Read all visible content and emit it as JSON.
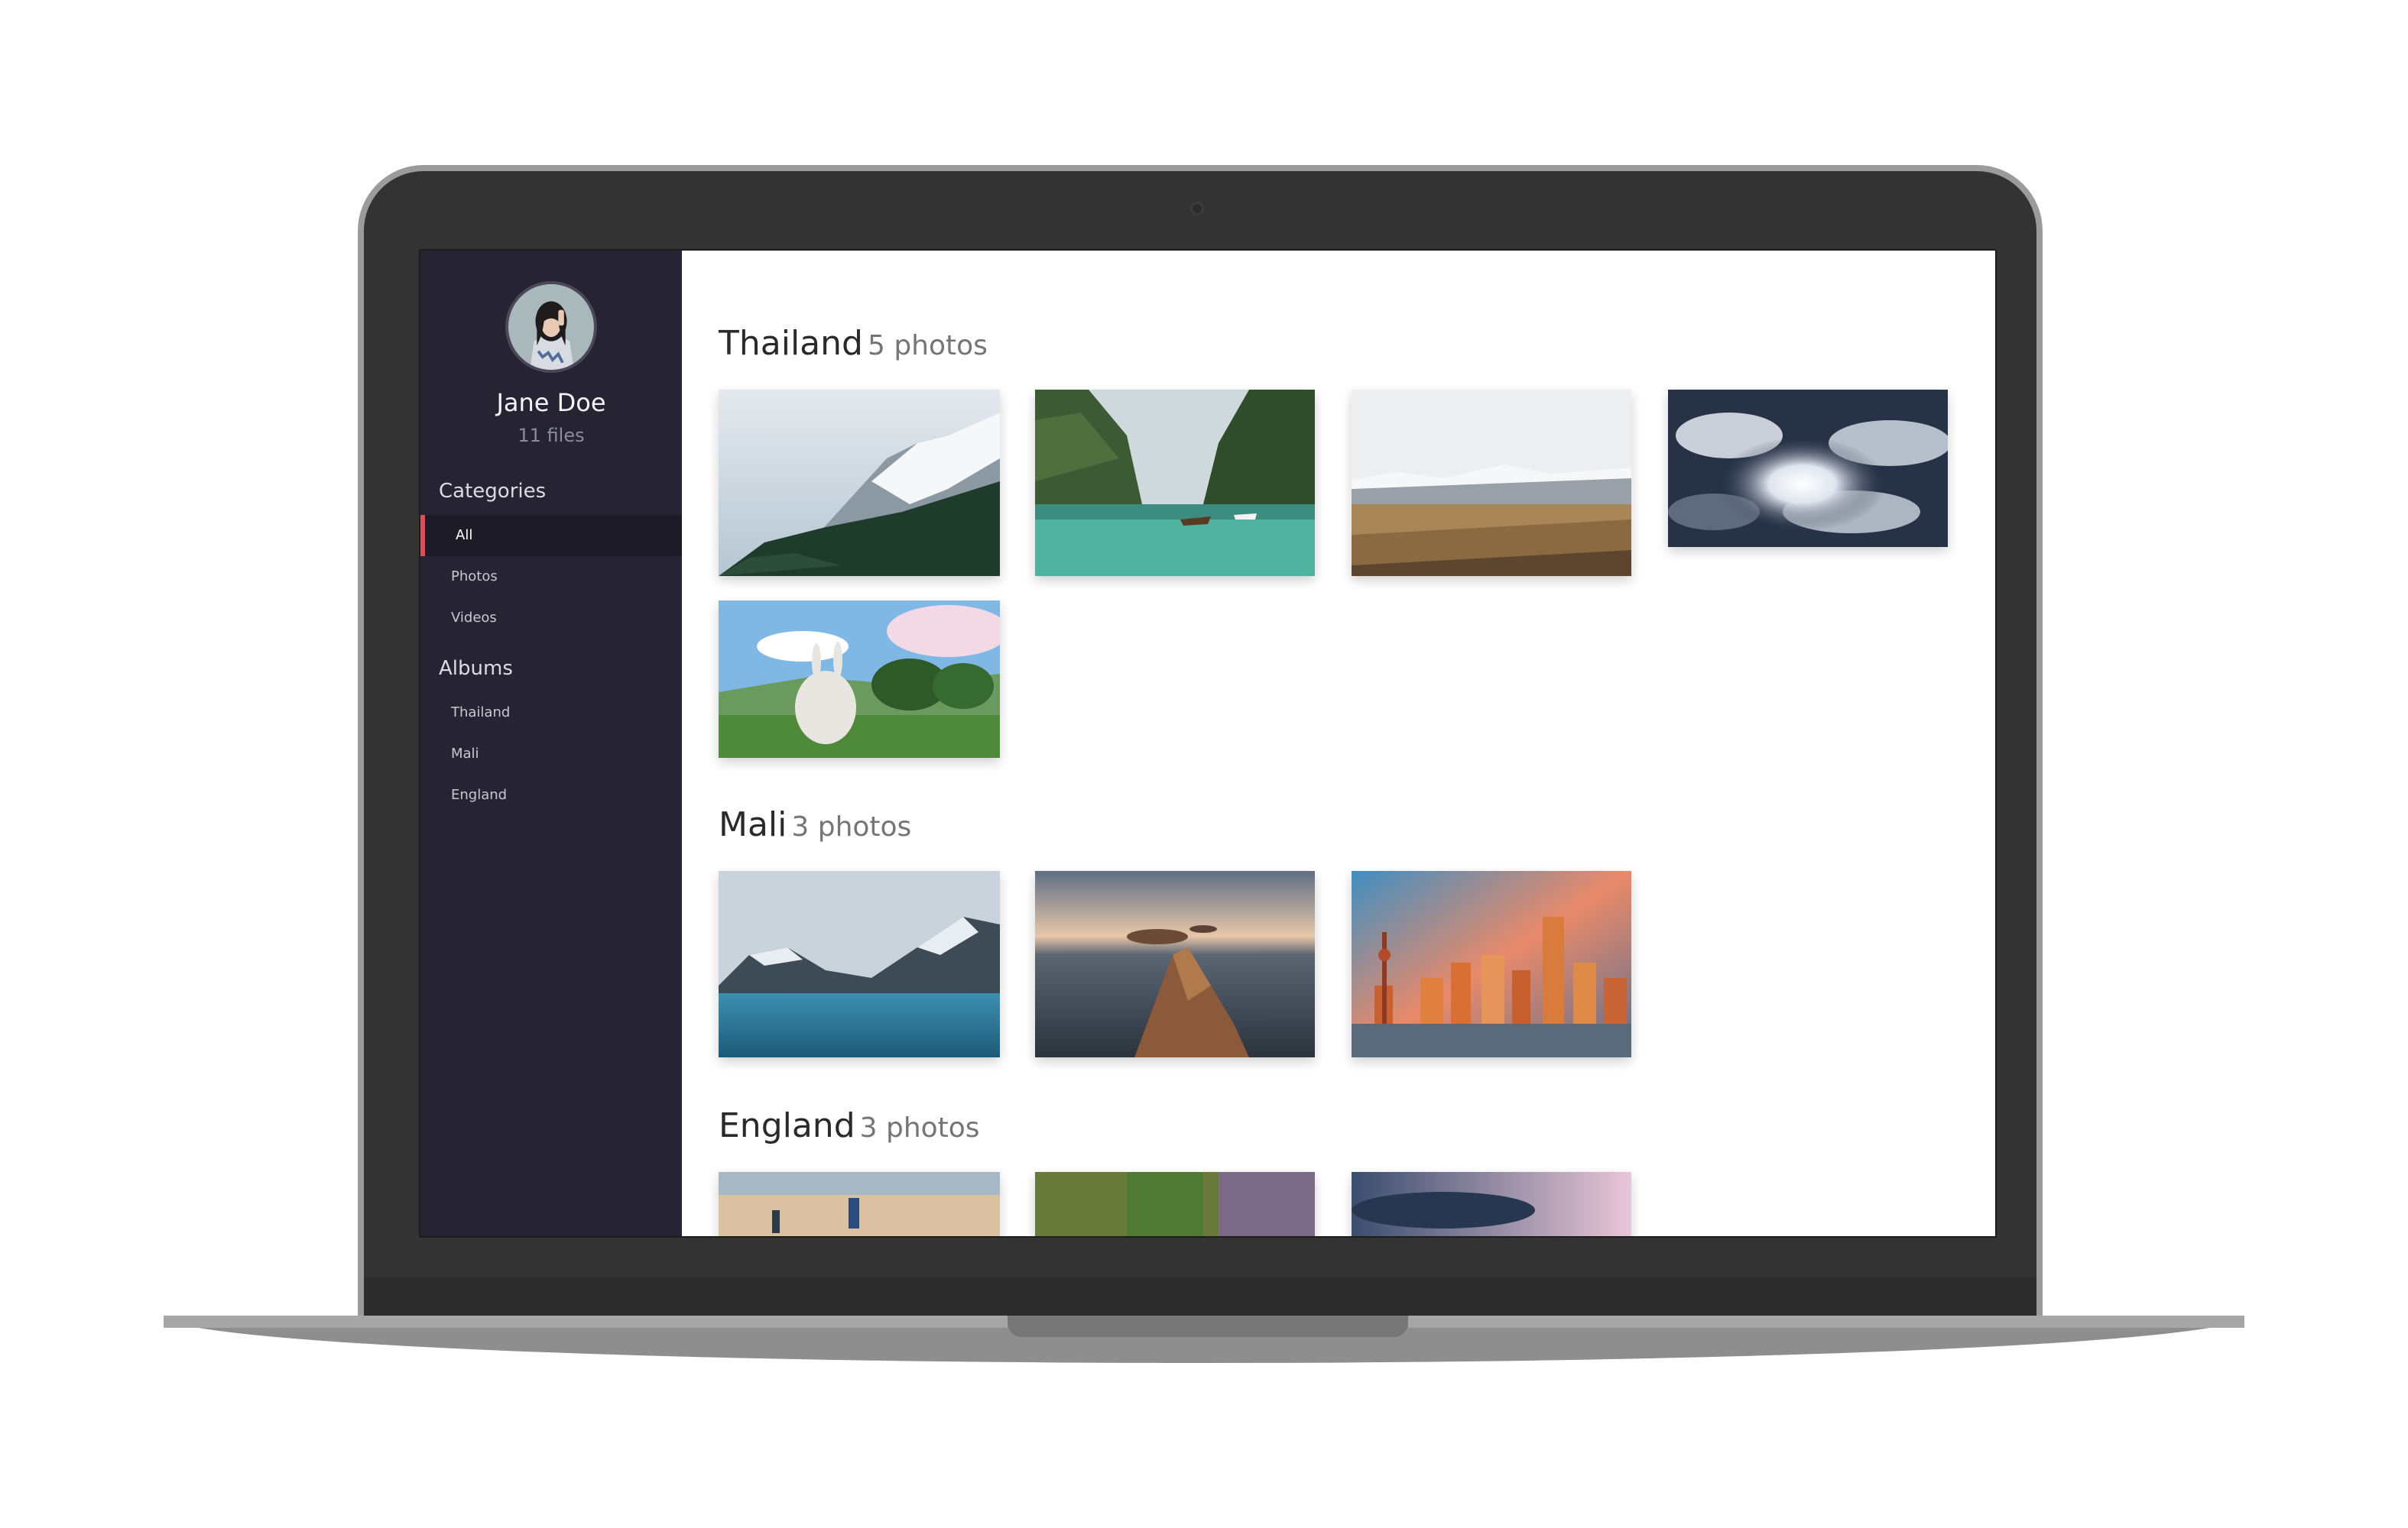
{
  "user": {
    "name": "Jane Doe",
    "files": "11 files"
  },
  "sidebar": {
    "categories_title": "Categories",
    "categories": [
      {
        "label": "All",
        "active": true
      },
      {
        "label": "Photos",
        "active": false
      },
      {
        "label": "Videos",
        "active": false
      }
    ],
    "albums_title": "Albums",
    "albums": [
      {
        "label": "Thailand"
      },
      {
        "label": "Mali"
      },
      {
        "label": "England"
      }
    ]
  },
  "gallery": [
    {
      "name": "Thailand",
      "count": "5 photos",
      "photos": [
        "snowy-mountain-forest",
        "tropical-cove-boats",
        "snowy-plains",
        "cloudy-sky-sun",
        "cartoon-bunny-meadow"
      ]
    },
    {
      "name": "Mali",
      "count": "3 photos",
      "photos": [
        "mountain-lake",
        "rocky-coast-aerial",
        "city-skyline-sunset"
      ]
    },
    {
      "name": "England",
      "count": "3 photos",
      "photos": [
        "foggy-landscape",
        "green-purple-field",
        "dusky-sky"
      ]
    }
  ],
  "colors": {
    "sidebar_bg": "#262432",
    "active_accent": "#e04b5a",
    "laptop_body": "#333333"
  }
}
